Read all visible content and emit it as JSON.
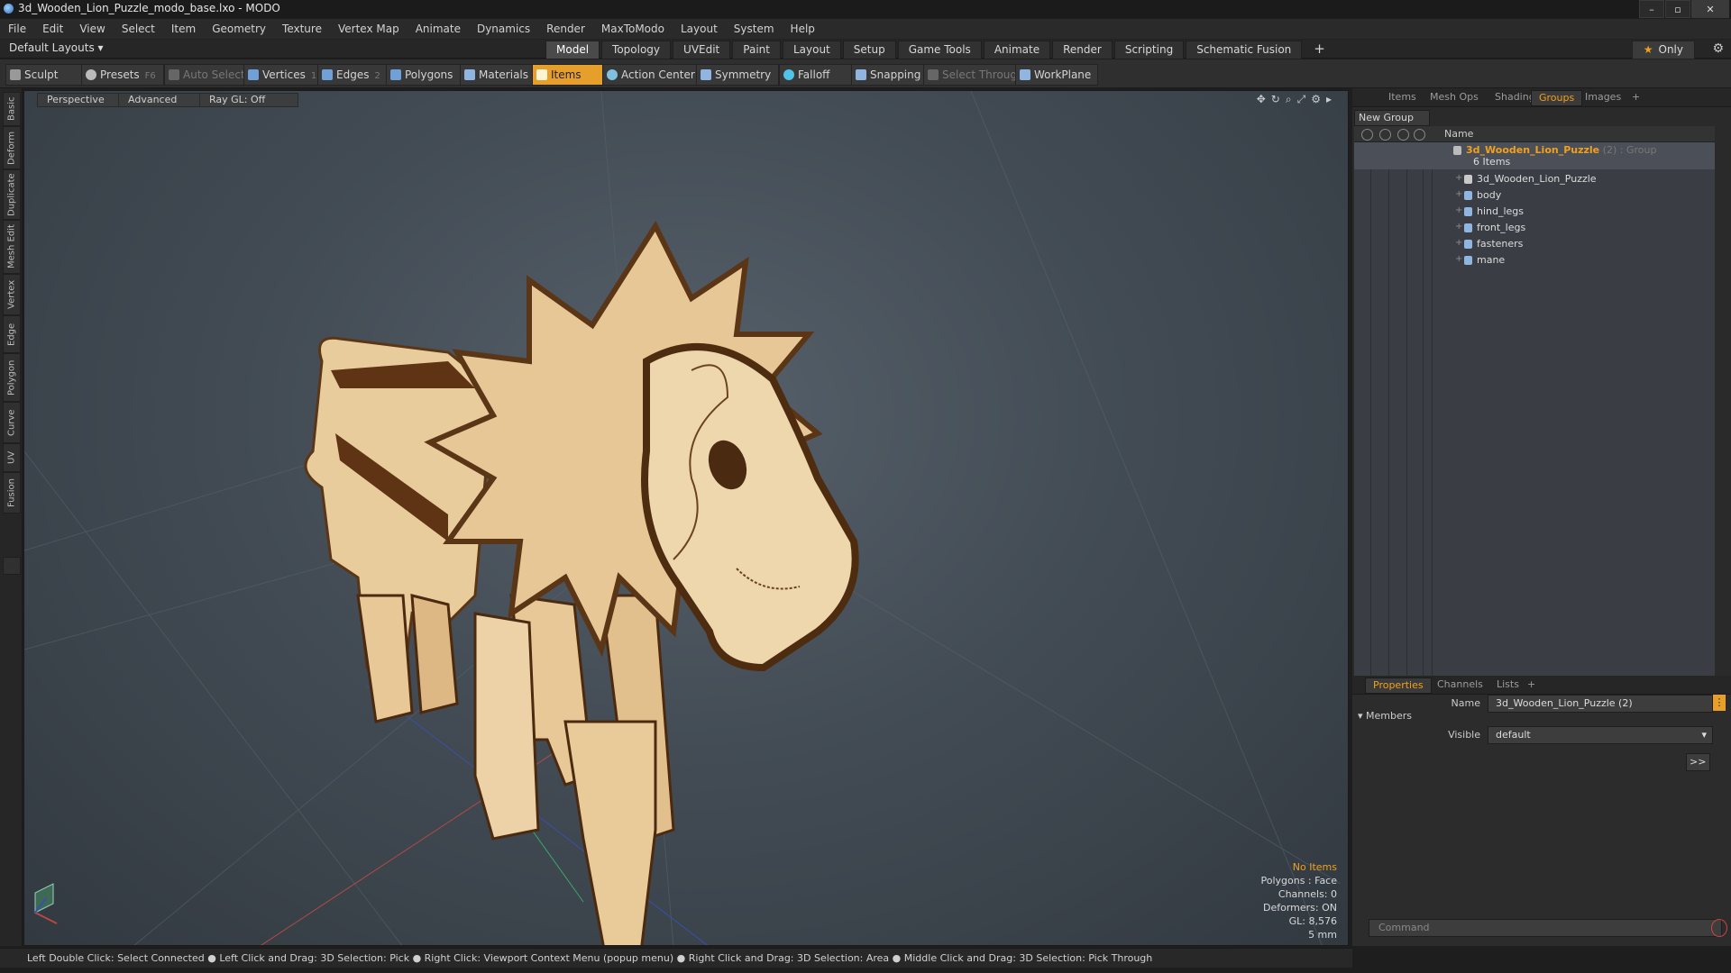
{
  "window": {
    "title": "3d_Wooden_Lion_Puzzle_modo_base.lxo - MODO",
    "min": "–",
    "max": "▫",
    "close": "✕"
  },
  "menu": [
    "File",
    "Edit",
    "View",
    "Select",
    "Item",
    "Geometry",
    "Texture",
    "Vertex Map",
    "Animate",
    "Dynamics",
    "Render",
    "MaxToModo",
    "Layout",
    "System",
    "Help"
  ],
  "layout_bar": {
    "default_layouts": "Default Layouts ▾",
    "tabs": [
      "Model",
      "Topology",
      "UVEdit",
      "Paint",
      "Layout",
      "Setup",
      "Game Tools",
      "Animate",
      "Render",
      "Scripting",
      "Schematic Fusion"
    ],
    "active_tab": "Model",
    "plus": "+",
    "only": "Only"
  },
  "toolbar": {
    "sculpt": "Sculpt",
    "presets": "Presets",
    "presets_key": "F6",
    "auto_select": "Auto Select",
    "vertices": "Vertices",
    "vertices_key": "1",
    "edges": "Edges",
    "edges_key": "2",
    "polygons": "Polygons",
    "materials": "Materials",
    "items": "Items",
    "action_center": "Action Center",
    "symmetry": "Symmetry",
    "falloff": "Falloff",
    "snapping": "Snapping",
    "select_through": "Select Through",
    "workplane": "WorkPlane"
  },
  "left_tabs": [
    "Basic",
    "Deform",
    "Duplicate",
    "Mesh Edit",
    "Vertex",
    "Edge",
    "Polygon",
    "Curve",
    "UV",
    "Fusion"
  ],
  "viewport": {
    "perspective": "Perspective",
    "advanced": "Advanced",
    "raygl": "Ray GL: Off",
    "info": {
      "no_items": "No Items",
      "polygons": "Polygons : Face",
      "channels": "Channels: 0",
      "deformers": "Deformers: ON",
      "gl": "GL: 8,576",
      "scale": "5 mm"
    }
  },
  "right_panel": {
    "tabs": [
      "Items",
      "Mesh Ops",
      "Shading",
      "Groups",
      "Images"
    ],
    "active_tab": "Groups",
    "plus": "+",
    "new_group": "New Group",
    "name_col": "Name",
    "group": {
      "name": "3d_Wooden_Lion_Puzzle",
      "suffix": "(2) : Group",
      "count": "6 Items"
    },
    "items": [
      "3d_Wooden_Lion_Puzzle",
      "body",
      "hind_legs",
      "front_legs",
      "fasteners",
      "mane"
    ]
  },
  "properties": {
    "tabs": [
      "Properties",
      "Channels",
      "Lists"
    ],
    "active_tab": "Properties",
    "plus": "+",
    "name_label": "Name",
    "name_value": "3d_Wooden_Lion_Puzzle (2)",
    "members": "Members",
    "visible_label": "Visible",
    "visible_value": "default",
    "more": ">>",
    "command_placeholder": "Command"
  },
  "status": "Left Double Click: Select Connected ● Left Click and Drag: 3D Selection: Pick ● Right Click: Viewport Context Menu (popup menu) ● Right Click and Drag: 3D Selection: Area ● Middle Click and Drag: 3D Selection: Pick Through"
}
